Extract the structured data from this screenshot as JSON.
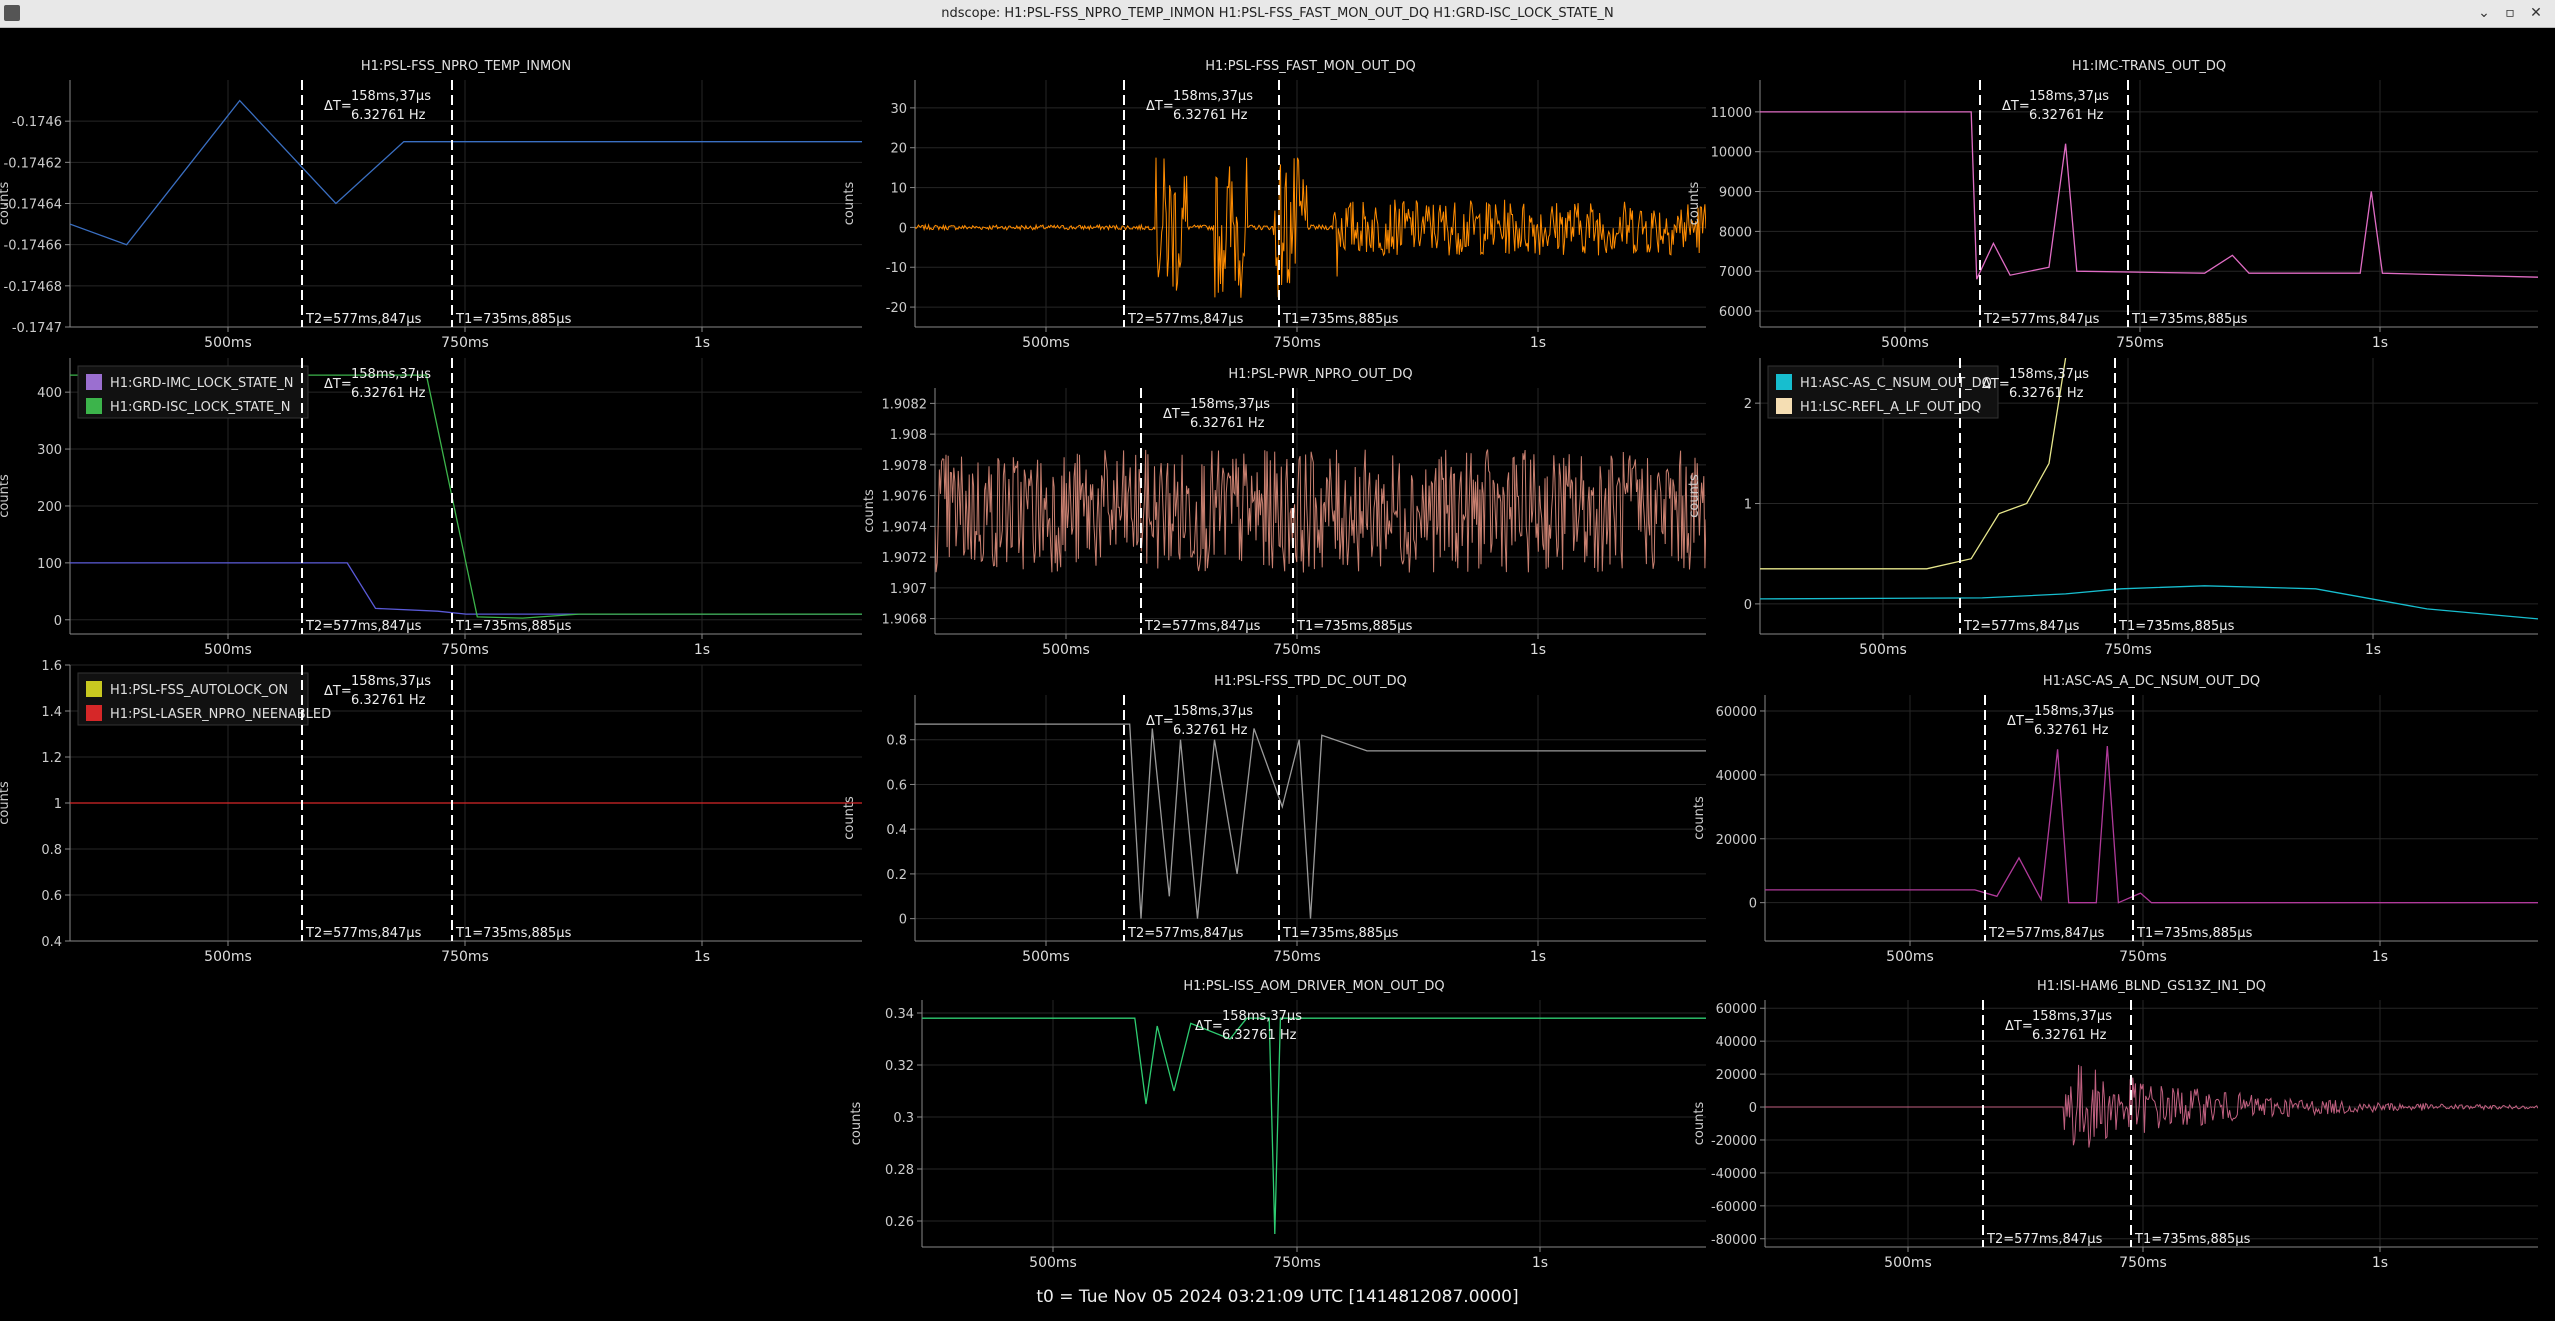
{
  "window": {
    "title": "ndscope: H1:PSL-FSS_NPRO_TEMP_INMON H1:PSL-FSS_FAST_MON_OUT_DQ H1:GRD-ISC_LOCK_STATE_N",
    "minimize": "⌄",
    "maximize": "▫",
    "close": "✕"
  },
  "cursors": {
    "delta_label": "ΔT=",
    "delta_value": "158ms,37μs",
    "delta_freq": "6.32761 Hz",
    "t2_label": "T2=577ms,847μs",
    "t1_label": "T1=735ms,885μs"
  },
  "x_ticks": [
    "500ms",
    "750ms",
    "1s"
  ],
  "y_axis_label": "counts",
  "footer": "t0 = Tue Nov 05 2024 03:21:09 UTC [1414812087.0000]",
  "plots": [
    {
      "id": "npro-temp",
      "title": "H1:PSL-FSS_NPRO_TEMP_INMON",
      "y_ticks": [
        "-0.1746",
        "-0.17462",
        "-0.17464",
        "-0.17466",
        "-0.17468",
        "-0.1747"
      ],
      "y_range": [
        -0.1747,
        -0.17458
      ],
      "series": [
        {
          "color": "#3a6fc2",
          "kind": "line",
          "points": [
            [
              0.2,
              -0.17465
            ],
            [
              0.3,
              -0.17466
            ],
            [
              0.5,
              -0.17459
            ],
            [
              0.67,
              -0.17464
            ],
            [
              0.79,
              -0.17461
            ],
            [
              1.6,
              -0.17461
            ]
          ]
        }
      ]
    },
    {
      "id": "fast-mon",
      "title": "H1:PSL-FSS_FAST_MON_OUT_DQ",
      "y_ticks": [
        "30",
        "20",
        "10",
        "0",
        "-10",
        "-20"
      ],
      "y_range": [
        -25,
        37
      ],
      "series": [
        {
          "color": "#ff8c00",
          "kind": "noise",
          "base": 0,
          "spread": 0.5
        }
      ]
    },
    {
      "id": "imc-trans",
      "title": "H1:IMC-TRANS_OUT_DQ",
      "y_ticks": [
        "11000",
        "10000",
        "9000",
        "8000",
        "7000",
        "6000"
      ],
      "y_range": [
        5600,
        11800
      ],
      "series": [
        {
          "color": "#e06cc4",
          "kind": "line",
          "points": [
            [
              0.2,
              11000
            ],
            [
              0.58,
              11000
            ],
            [
              0.59,
              6800
            ],
            [
              0.62,
              7700
            ],
            [
              0.65,
              6900
            ],
            [
              0.72,
              7100
            ],
            [
              0.75,
              10200
            ],
            [
              0.77,
              7000
            ],
            [
              1.0,
              6950
            ],
            [
              1.05,
              7400
            ],
            [
              1.08,
              6950
            ],
            [
              1.28,
              6950
            ],
            [
              1.3,
              9000
            ],
            [
              1.32,
              6950
            ],
            [
              1.6,
              6850
            ]
          ]
        }
      ]
    },
    {
      "id": "lock-state",
      "title": "",
      "y_ticks": [
        "400",
        "300",
        "200",
        "100",
        "0"
      ],
      "y_range": [
        -25,
        460
      ],
      "legend": [
        {
          "label": "H1:GRD-IMC_LOCK_STATE_N",
          "color": "#9b6fd0"
        },
        {
          "label": "H1:GRD-ISC_LOCK_STATE_N",
          "color": "#3cb44b"
        }
      ],
      "series": [
        {
          "color": "#5a5ad8",
          "kind": "line",
          "points": [
            [
              0.2,
              100
            ],
            [
              0.69,
              100
            ],
            [
              0.74,
              20
            ],
            [
              0.85,
              15
            ],
            [
              0.9,
              10
            ],
            [
              1.6,
              10
            ]
          ]
        },
        {
          "color": "#3cb44b",
          "kind": "line",
          "points": [
            [
              0.2,
              430
            ],
            [
              0.83,
              430
            ],
            [
              0.92,
              5
            ],
            [
              1.0,
              3
            ],
            [
              1.1,
              10
            ],
            [
              1.6,
              10
            ]
          ]
        }
      ]
    },
    {
      "id": "pwr-npro",
      "title": "H1:PSL-PWR_NPRO_OUT_DQ",
      "y_ticks": [
        "1.9082",
        "1.908",
        "1.9078",
        "1.9076",
        "1.9074",
        "1.9072",
        "1.907",
        "1.9068"
      ],
      "y_range": [
        1.9067,
        1.9083
      ],
      "series": [
        {
          "color": "#c98070",
          "kind": "noise",
          "base": 1.9075,
          "spread": 0.0004
        }
      ]
    },
    {
      "id": "asc-nsum",
      "title": "",
      "y_ticks": [
        "2",
        "1",
        "0"
      ],
      "y_range": [
        -0.3,
        2.45
      ],
      "legend": [
        {
          "label": "H1:ASC-AS_C_NSUM_OUT_DQ",
          "color": "#17becf"
        },
        {
          "label": "H1:LSC-REFL_A_LF_OUT_DQ",
          "color": "#f5deb3"
        }
      ],
      "series": [
        {
          "color": "#17becf",
          "kind": "line",
          "points": [
            [
              0.2,
              0.05
            ],
            [
              0.6,
              0.06
            ],
            [
              0.75,
              0.1
            ],
            [
              0.85,
              0.15
            ],
            [
              1.0,
              0.18
            ],
            [
              1.2,
              0.15
            ],
            [
              1.4,
              -0.05
            ],
            [
              1.6,
              -0.15
            ]
          ]
        },
        {
          "color": "#e6e68c",
          "kind": "line",
          "points": [
            [
              0.2,
              0.35
            ],
            [
              0.5,
              0.35
            ],
            [
              0.58,
              0.45
            ],
            [
              0.63,
              0.9
            ],
            [
              0.68,
              1.0
            ],
            [
              0.72,
              1.4
            ],
            [
              0.75,
              2.45
            ]
          ]
        }
      ]
    },
    {
      "id": "autolock",
      "title": "",
      "y_ticks": [
        "1.6",
        "1.4",
        "1.2",
        "1",
        "0.8",
        "0.6",
        "0.4"
      ],
      "y_range": [
        0.4,
        1.6
      ],
      "legend": [
        {
          "label": "H1:PSL-FSS_AUTOLOCK_ON",
          "color": "#c8c820"
        },
        {
          "label": "H1:PSL-LASER_NPRO_NEENABLED",
          "color": "#d62728"
        }
      ],
      "series": [
        {
          "color": "#d62728",
          "kind": "line",
          "points": [
            [
              0.2,
              1
            ],
            [
              1.6,
              1
            ]
          ]
        }
      ]
    },
    {
      "id": "tpd-dc",
      "title": "H1:PSL-FSS_TPD_DC_OUT_DQ",
      "y_ticks": [
        "0.8",
        "0.6",
        "0.4",
        "0.2",
        "0"
      ],
      "y_range": [
        -0.1,
        1.0
      ],
      "series": [
        {
          "color": "#9a9a9a",
          "kind": "line",
          "points": [
            [
              0.2,
              0.87
            ],
            [
              0.58,
              0.87
            ],
            [
              0.6,
              0.0
            ],
            [
              0.62,
              0.85
            ],
            [
              0.65,
              0.1
            ],
            [
              0.67,
              0.8
            ],
            [
              0.7,
              0.0
            ],
            [
              0.73,
              0.8
            ],
            [
              0.77,
              0.2
            ],
            [
              0.8,
              0.85
            ],
            [
              0.85,
              0.5
            ],
            [
              0.88,
              0.8
            ],
            [
              0.9,
              0.0
            ],
            [
              0.92,
              0.82
            ],
            [
              1.0,
              0.75
            ],
            [
              1.6,
              0.75
            ]
          ]
        }
      ]
    },
    {
      "id": "iss-aom",
      "title": "H1:PSL-ISS_AOM_DRIVER_MON_OUT_DQ",
      "y_ticks": [
        "0.34",
        "0.32",
        "0.3",
        "0.28",
        "0.26"
      ],
      "y_range": [
        0.25,
        0.345
      ],
      "series": [
        {
          "color": "#2ecc71",
          "kind": "line",
          "points": [
            [
              0.2,
              0.338
            ],
            [
              0.58,
              0.338
            ],
            [
              0.6,
              0.305
            ],
            [
              0.62,
              0.335
            ],
            [
              0.65,
              0.31
            ],
            [
              0.68,
              0.336
            ],
            [
              0.75,
              0.33
            ],
            [
              0.78,
              0.338
            ],
            [
              0.82,
              0.338
            ],
            [
              0.83,
              0.255
            ],
            [
              0.84,
              0.338
            ],
            [
              1.6,
              0.338
            ]
          ]
        }
      ]
    },
    {
      "id": "as-a-dc",
      "title": "H1:ASC-AS_A_DC_NSUM_OUT_DQ",
      "y_ticks": [
        "60000",
        "40000",
        "20000",
        "0"
      ],
      "y_range": [
        -12000,
        65000
      ],
      "series": [
        {
          "color": "#b03a9a",
          "kind": "line",
          "points": [
            [
              0.2,
              4000
            ],
            [
              0.58,
              4000
            ],
            [
              0.62,
              2000
            ],
            [
              0.66,
              14000
            ],
            [
              0.7,
              1000
            ],
            [
              0.73,
              48000
            ],
            [
              0.75,
              0
            ],
            [
              0.8,
              0
            ],
            [
              0.82,
              49000
            ],
            [
              0.84,
              0
            ],
            [
              0.88,
              3000
            ],
            [
              0.9,
              0
            ],
            [
              1.6,
              0
            ]
          ]
        }
      ]
    },
    {
      "id": "isi-ham6",
      "title": "H1:ISI-HAM6_BLND_GS13Z_IN1_DQ",
      "y_ticks": [
        "60000",
        "40000",
        "20000",
        "0",
        "-20000",
        "-40000",
        "-60000",
        "-80000"
      ],
      "y_range": [
        -85000,
        65000
      ],
      "series": [
        {
          "color": "#c06080",
          "kind": "decay",
          "base": 0,
          "start": 0.74,
          "amp": 30000
        }
      ]
    }
  ]
}
